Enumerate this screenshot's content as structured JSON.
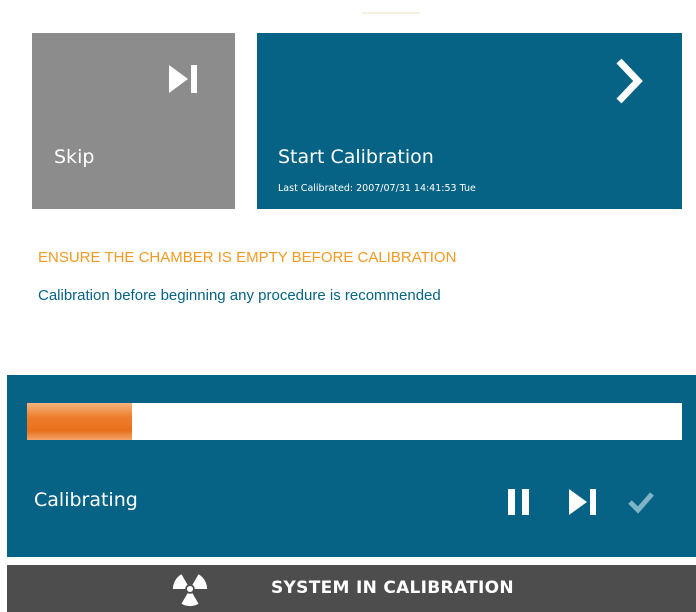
{
  "skip_tile": {
    "label": "Skip",
    "icon": "skip-forward-icon"
  },
  "start_tile": {
    "label": "Start Calibration",
    "last_calibrated": "Last Calibrated: 2007/07/31 14:41:53 Tue",
    "icon": "chevron-right-icon"
  },
  "messages": {
    "warning": "ENSURE THE CHAMBER IS EMPTY BEFORE CALIBRATION",
    "recommendation": "Calibration before beginning any procedure is recommended"
  },
  "calibration_panel": {
    "status": "Calibrating",
    "progress_fraction": 0.16,
    "controls": [
      "pause-icon",
      "skip-forward-icon",
      "checkmark-icon"
    ]
  },
  "status_bar": {
    "text": "SYSTEM IN CALIBRATION",
    "icon": "radiation-icon"
  },
  "colors": {
    "primary": "#066385",
    "skip_tile": "#8c8c8c",
    "warning": "#f29a22",
    "progress": "#ee7c2a",
    "status_bar": "#4d4d4d",
    "check_disabled": "#7fb3c6"
  }
}
